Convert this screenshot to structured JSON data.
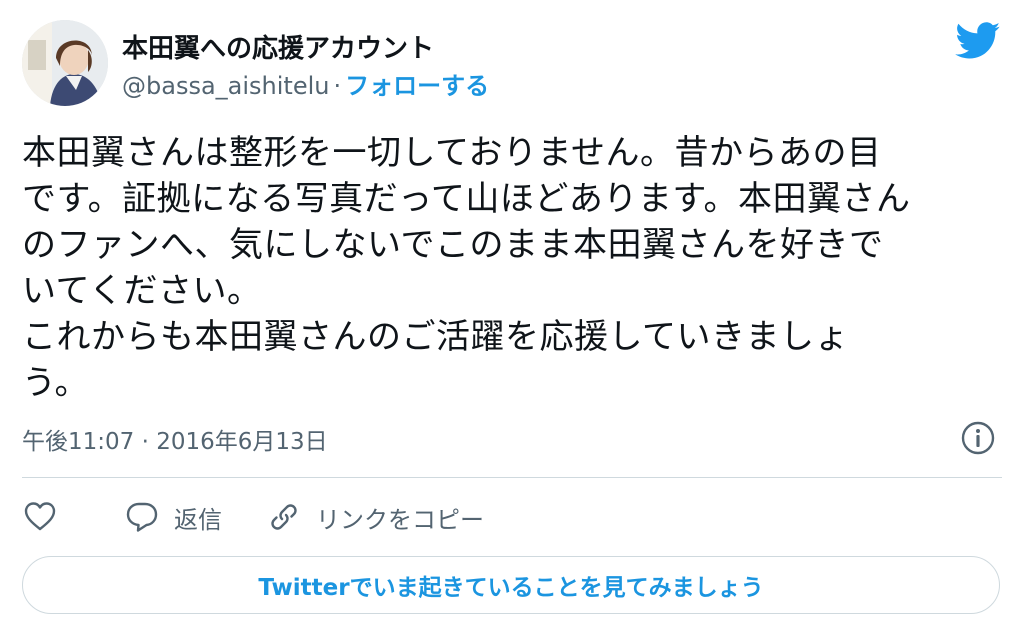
{
  "author": {
    "display_name": "本田翼への応援アカウント",
    "handle": "@bassa_aishitelu",
    "separator": "·",
    "follow_label": "フォローする",
    "avatar_icon": "profile-photo"
  },
  "brand": {
    "logo_icon": "twitter-bird-icon",
    "accent_color": "#1b95e0"
  },
  "tweet": {
    "text": "本田翼さんは整形を一切しておりません。昔からあの目\nです。証拠になる写真だって山ほどあります。本田翼さん\nのファンへ、気にしないでこのまま本田翼さんを好きで\nいてください。\nこれからも本田翼さんのご活躍を応援していきましょ\nう。",
    "timestamp": "午後11:07 · 2016年6月13日"
  },
  "actions": {
    "like_icon": "heart-icon",
    "reply_label": "返信",
    "reply_icon": "speech-bubble-icon",
    "copy_link_label": "リンクをコピー",
    "copy_link_icon": "link-icon"
  },
  "info_icon": "info-icon",
  "cta_label": "Twitterでいま起きていることを見てみましょう"
}
